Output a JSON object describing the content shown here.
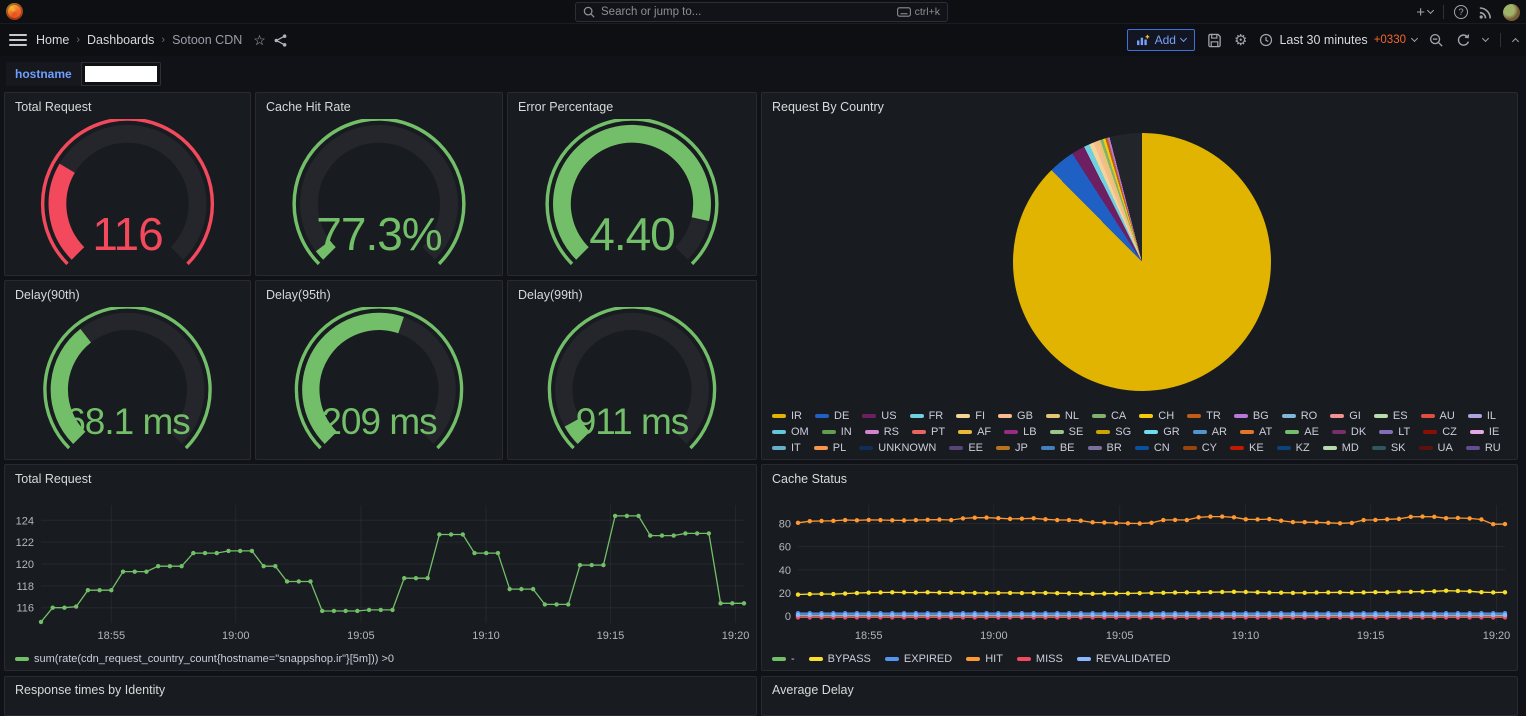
{
  "topnav": {
    "search_placeholder": "Search or jump to...",
    "search_shortcut": "ctrl+k"
  },
  "toolbar": {
    "breadcrumb": [
      "Home",
      "Dashboards",
      "Sotoon CDN"
    ],
    "add_label": "Add",
    "time_range_label": "Last 30 minutes",
    "time_zone_offset": "+0330"
  },
  "submenu": {
    "variable_label": "hostname",
    "variable_value": ""
  },
  "bottom_panels": {
    "left_title": "Response times by Identity",
    "right_title": "Average Delay"
  },
  "colors": {
    "green": "#73BF69",
    "red": "#F2495C",
    "accent_blue": "#3D71D9",
    "hit_orange": "#FF9830",
    "bypass_yellow": "#FADE2A",
    "panel_bg": "#181b1f",
    "page_bg": "#111217"
  },
  "chart_data": [
    {
      "id": "gauge-total-request",
      "type": "gauge",
      "title": "Total Request",
      "value_text": "116",
      "value": 116,
      "percent": 28,
      "color": "#F2495C"
    },
    {
      "id": "gauge-cache-hit-rate",
      "type": "gauge",
      "title": "Cache Hit Rate",
      "value_text": "77.3%",
      "value": 77.3,
      "percent": 3,
      "color": "#73BF69"
    },
    {
      "id": "gauge-error-percentage",
      "type": "gauge",
      "title": "Error Percentage",
      "value_text": "4.40",
      "value": 4.4,
      "percent": 88,
      "color": "#73BF69"
    },
    {
      "id": "gauge-delay-90th",
      "type": "gauge",
      "title": "Delay(90th)",
      "value_text": "68.1 ms",
      "value": 68.1,
      "percent": 36,
      "color": "#73BF69"
    },
    {
      "id": "gauge-delay-95th",
      "type": "gauge",
      "title": "Delay(95th)",
      "value_text": "209 ms",
      "value": 209,
      "percent": 57,
      "color": "#73BF69"
    },
    {
      "id": "gauge-delay-99th",
      "type": "gauge",
      "title": "Delay(99th)",
      "value_text": "911 ms",
      "value": 911,
      "percent": 6,
      "color": "#73BF69"
    },
    {
      "id": "pie-request-by-country",
      "type": "pie",
      "title": "Request By Country",
      "slices": [
        {
          "label": "IR",
          "color": "#E0B400",
          "pct": 87.6
        },
        {
          "label": "DE",
          "color": "#1F60C4",
          "pct": 3.3
        },
        {
          "label": "US",
          "color": "#6D1F62",
          "pct": 1.7
        },
        {
          "label": "FR",
          "color": "#6ED0E0",
          "pct": 0.7
        },
        {
          "label": "FI",
          "color": "#F4D598",
          "pct": 0.55
        },
        {
          "label": "GB",
          "color": "#F9BA8F",
          "pct": 0.5
        },
        {
          "label": "NL",
          "color": "#E5C572",
          "pct": 0.4
        },
        {
          "label": "CA",
          "color": "#7EB26D",
          "pct": 0.35
        },
        {
          "label": "CH",
          "color": "#F2CC0C",
          "pct": 0.3
        },
        {
          "label": "TR",
          "color": "#C15C17",
          "pct": 0.3
        },
        {
          "label": "BG",
          "color": "#B877D9",
          "pct": 0.25
        },
        {
          "label": "",
          "color": "#22252A",
          "pct": 4.05
        }
      ],
      "legend": [
        {
          "label": "IR",
          "color": "#E0B400"
        },
        {
          "label": "DE",
          "color": "#1F60C4"
        },
        {
          "label": "US",
          "color": "#6D1F62"
        },
        {
          "label": "FR",
          "color": "#6ED0E0"
        },
        {
          "label": "FI",
          "color": "#F4D598"
        },
        {
          "label": "GB",
          "color": "#F9BA8F"
        },
        {
          "label": "NL",
          "color": "#E5C572"
        },
        {
          "label": "CA",
          "color": "#7EB26D"
        },
        {
          "label": "CH",
          "color": "#F2CC0C"
        },
        {
          "label": "TR",
          "color": "#C15C17"
        },
        {
          "label": "BG",
          "color": "#B877D9"
        },
        {
          "label": "RO",
          "color": "#82B5D8"
        },
        {
          "label": "GI",
          "color": "#F29191"
        },
        {
          "label": "ES",
          "color": "#B7DBAB"
        },
        {
          "label": "AU",
          "color": "#E24D42"
        },
        {
          "label": "IL",
          "color": "#AEA2E0"
        },
        {
          "label": "OM",
          "color": "#65C5DB"
        },
        {
          "label": "IN",
          "color": "#629E51"
        },
        {
          "label": "RS",
          "color": "#D683CE"
        },
        {
          "label": "PT",
          "color": "#EA6460"
        },
        {
          "label": "AF",
          "color": "#EAB839"
        },
        {
          "label": "LB",
          "color": "#962D82"
        },
        {
          "label": "SE",
          "color": "#9AC48A"
        },
        {
          "label": "SG",
          "color": "#CCA300"
        },
        {
          "label": "GR",
          "color": "#70DBED"
        },
        {
          "label": "AR",
          "color": "#5195CE"
        },
        {
          "label": "AT",
          "color": "#E0752D"
        },
        {
          "label": "AE",
          "color": "#73BF69"
        },
        {
          "label": "DK",
          "color": "#75306A"
        },
        {
          "label": "LT",
          "color": "#806EB7"
        },
        {
          "label": "CZ",
          "color": "#890F02"
        },
        {
          "label": "IE",
          "color": "#E5A8E2"
        },
        {
          "label": "IT",
          "color": "#64B0C8"
        },
        {
          "label": "PL",
          "color": "#F9934E"
        },
        {
          "label": "UNKNOWN",
          "color": "#0E2F55"
        },
        {
          "label": "EE",
          "color": "#584477"
        },
        {
          "label": "JP",
          "color": "#B8741A"
        },
        {
          "label": "BE",
          "color": "#447EBC"
        },
        {
          "label": "BR",
          "color": "#7B6F9E"
        },
        {
          "label": "CN",
          "color": "#0A50A1"
        },
        {
          "label": "CY",
          "color": "#99440A"
        },
        {
          "label": "KE",
          "color": "#BF1B00"
        },
        {
          "label": "KZ",
          "color": "#0A437C"
        },
        {
          "label": "MD",
          "color": "#B7DBAB"
        },
        {
          "label": "SK",
          "color": "#2F575E"
        },
        {
          "label": "UA",
          "color": "#58140C"
        },
        {
          "label": "RU",
          "color": "#614D93"
        }
      ]
    },
    {
      "id": "ts-total-request",
      "type": "line",
      "title": "Total Request",
      "ylim": [
        114.6,
        125.4
      ],
      "yticks": [
        116,
        118,
        120,
        122,
        124
      ],
      "xticks": [
        {
          "label": "18:55",
          "f": 0.1
        },
        {
          "label": "19:00",
          "f": 0.277
        },
        {
          "label": "19:05",
          "f": 0.455
        },
        {
          "label": "19:10",
          "f": 0.633
        },
        {
          "label": "19:15",
          "f": 0.81
        },
        {
          "label": "19:20",
          "f": 0.988
        }
      ],
      "series": [
        {
          "name": "sum(rate(cdn_request_country_count{hostname=\"snappshop.ir\"}[5m])) >0",
          "color": "#73BF69",
          "values": [
            114.7,
            116.0,
            116.0,
            116.1,
            117.6,
            117.6,
            117.6,
            119.3,
            119.3,
            119.3,
            119.8,
            119.8,
            119.8,
            121.0,
            121.0,
            121.0,
            121.2,
            121.2,
            121.2,
            119.8,
            119.8,
            118.4,
            118.4,
            118.4,
            115.7,
            115.7,
            115.7,
            115.7,
            115.8,
            115.8,
            115.8,
            118.7,
            118.7,
            118.7,
            122.7,
            122.7,
            122.7,
            121.0,
            121.0,
            121.0,
            117.7,
            117.7,
            117.7,
            116.3,
            116.3,
            116.3,
            119.9,
            119.9,
            119.9,
            124.4,
            124.4,
            124.4,
            122.6,
            122.6,
            122.6,
            122.8,
            122.8,
            122.8,
            116.4,
            116.4,
            116.4
          ]
        }
      ]
    },
    {
      "id": "ts-cache-status",
      "type": "line",
      "title": "Cache Status",
      "ylim": [
        -6,
        96
      ],
      "yticks": [
        0,
        20,
        40,
        60,
        80
      ],
      "xticks": [
        {
          "label": "18:55",
          "f": 0.1
        },
        {
          "label": "19:00",
          "f": 0.277
        },
        {
          "label": "19:05",
          "f": 0.455
        },
        {
          "label": "19:10",
          "f": 0.633
        },
        {
          "label": "19:15",
          "f": 0.81
        },
        {
          "label": "19:20",
          "f": 0.988
        }
      ],
      "series": [
        {
          "name": "-",
          "color": "#73BF69",
          "flat": 0.2,
          "n": 61
        },
        {
          "name": "BYPASS",
          "color": "#FADE2A",
          "values": [
            18.6,
            19.0,
            19.1,
            19.0,
            19.4,
            19.9,
            20.2,
            20.4,
            20.5,
            20.4,
            20.3,
            20.5,
            20.3,
            20.2,
            20.1,
            20.0,
            19.9,
            20.0,
            20.0,
            19.9,
            20.0,
            20.0,
            19.8,
            19.6,
            19.4,
            19.2,
            19.4,
            19.5,
            19.6,
            19.8,
            20.0,
            20.1,
            20.3,
            20.4,
            20.4,
            20.6,
            20.8,
            21.0,
            20.8,
            20.5,
            20.3,
            20.2,
            20.0,
            20.1,
            20.3,
            20.4,
            20.5,
            20.3,
            20.4,
            20.6,
            20.5,
            20.8,
            21.0,
            21.1,
            21.4,
            21.9,
            21.7,
            21.4,
            20.6,
            20.4,
            20.5
          ]
        },
        {
          "name": "EXPIRED",
          "color": "#5794F2",
          "flat": 2.5,
          "n": 61
        },
        {
          "name": "HIT",
          "color": "#FF9830",
          "values": [
            80.6,
            82.0,
            82.2,
            82.3,
            83.0,
            82.8,
            83.1,
            83.0,
            82.8,
            82.7,
            83.0,
            83.2,
            83.4,
            83.0,
            84.4,
            85.0,
            85.1,
            84.6,
            84.0,
            84.2,
            84.5,
            83.6,
            83.0,
            83.0,
            82.4,
            81.0,
            80.8,
            80.4,
            80.2,
            80.0,
            80.6,
            83.0,
            83.1,
            83.0,
            85.4,
            86.0,
            86.0,
            85.4,
            83.6,
            83.5,
            83.8,
            82.4,
            81.2,
            81.1,
            81.0,
            80.6,
            80.2,
            80.5,
            83.0,
            83.1,
            83.6,
            84.0,
            85.8,
            86.0,
            85.8,
            84.6,
            84.8,
            84.4,
            83.5,
            79.4,
            79.5
          ]
        },
        {
          "name": "MISS",
          "color": "#F2495C",
          "flat": -1.2,
          "n": 61
        },
        {
          "name": "REVALIDATED",
          "color": "#8AB8FF",
          "flat": 0.9,
          "n": 61
        }
      ]
    }
  ]
}
